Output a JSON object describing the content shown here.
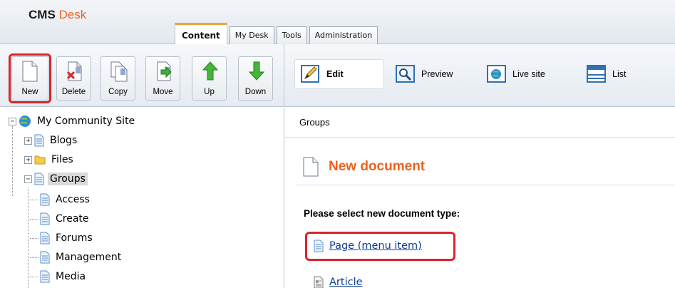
{
  "app": {
    "brand_primary": "CMS",
    "brand_secondary": "Desk",
    "accent": "#f0611f",
    "highlight": "#d9232d"
  },
  "tabs": [
    {
      "label": "Content",
      "active": true
    },
    {
      "label": "My Desk",
      "active": false
    },
    {
      "label": "Tools",
      "active": false
    },
    {
      "label": "Administration",
      "active": false
    }
  ],
  "toolbar": {
    "new": "New",
    "delete": "Delete",
    "copy": "Copy",
    "move": "Move",
    "up": "Up",
    "down": "Down"
  },
  "view_modes": {
    "edit": "Edit",
    "preview": "Preview",
    "live_site": "Live site",
    "list": "List"
  },
  "tree": {
    "root": "My Community Site",
    "items": [
      {
        "label": "Blogs",
        "icon": "page-icon"
      },
      {
        "label": "Files",
        "icon": "folder-icon"
      },
      {
        "label": "Groups",
        "icon": "page-icon",
        "selected": true
      },
      {
        "label": "Access",
        "icon": "page-icon"
      },
      {
        "label": "Create",
        "icon": "page-icon"
      },
      {
        "label": "Forums",
        "icon": "page-icon"
      },
      {
        "label": "Management",
        "icon": "page-icon"
      },
      {
        "label": "Media",
        "icon": "page-icon"
      }
    ]
  },
  "main": {
    "breadcrumb": "Groups",
    "title": "New document",
    "prompt": "Please select new document type:",
    "doc_types": [
      {
        "label": "Page (menu item)",
        "icon": "page-icon"
      },
      {
        "label": "Article",
        "icon": "article-icon"
      }
    ]
  }
}
